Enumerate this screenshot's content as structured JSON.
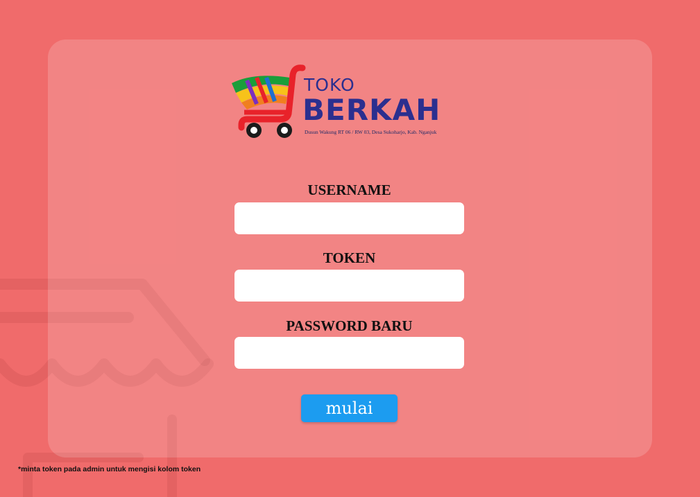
{
  "logo": {
    "line1": "TOKO",
    "line2": "BERKAH",
    "address": "Dusun Wakung RT 06 / RW 03, Desa Sukoharjo, Kab. Nganjuk"
  },
  "form": {
    "username_label": "USERNAME",
    "token_label": "TOKEN",
    "password_label": "PASSWORD BARU",
    "username_value": "",
    "token_value": "",
    "password_value": "",
    "submit_label": "mulai"
  },
  "footer": {
    "note": "*minta token pada admin untuk mengisi kolom token"
  },
  "colors": {
    "background": "#f06b6b",
    "card": "#f4857f",
    "button": "#1c9cf0",
    "brand_text": "#2b2f8f",
    "cart_red": "#e8222a"
  }
}
